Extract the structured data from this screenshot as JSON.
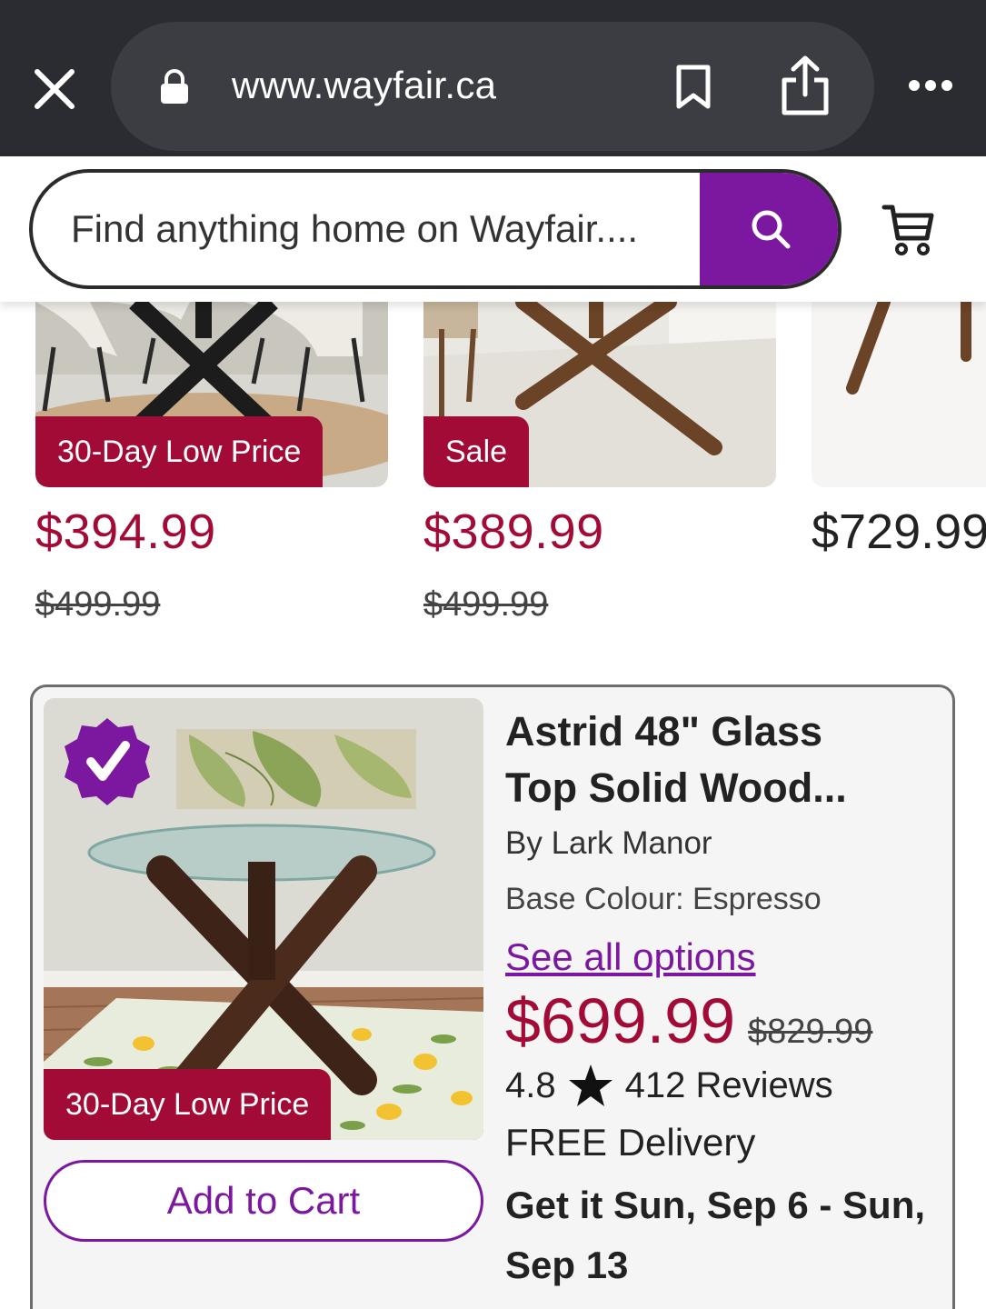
{
  "browser": {
    "url": "www.wayfair.ca"
  },
  "header": {
    "search_placeholder": "Find anything home on Wayfair....",
    "accent_color": "#7b189f"
  },
  "carousel": {
    "items": [
      {
        "badge": "30-Day Low Price",
        "price": "$394.99",
        "was_price": "$499.99"
      },
      {
        "badge": "Sale",
        "price": "$389.99",
        "was_price": "$499.99"
      },
      {
        "price": "$729.99"
      }
    ],
    "sale_color": "#a30b37"
  },
  "product": {
    "badge": "30-Day Low Price",
    "title_line1": "Astrid 48\" Glass",
    "title_line2": "Top Solid Wood...",
    "brand": "By Lark Manor",
    "base_colour": "Base Colour: Espresso",
    "options_link": "See all options",
    "price": "$699.99",
    "was_price": "$829.99",
    "rating": "4.8",
    "reviews": "412 Reviews",
    "delivery": "FREE Delivery",
    "delivery_date_line1": "Get it Sun, Sep 6 - Sun,",
    "delivery_date_line2": "Sep 13",
    "add_to_cart": "Add to Cart"
  }
}
